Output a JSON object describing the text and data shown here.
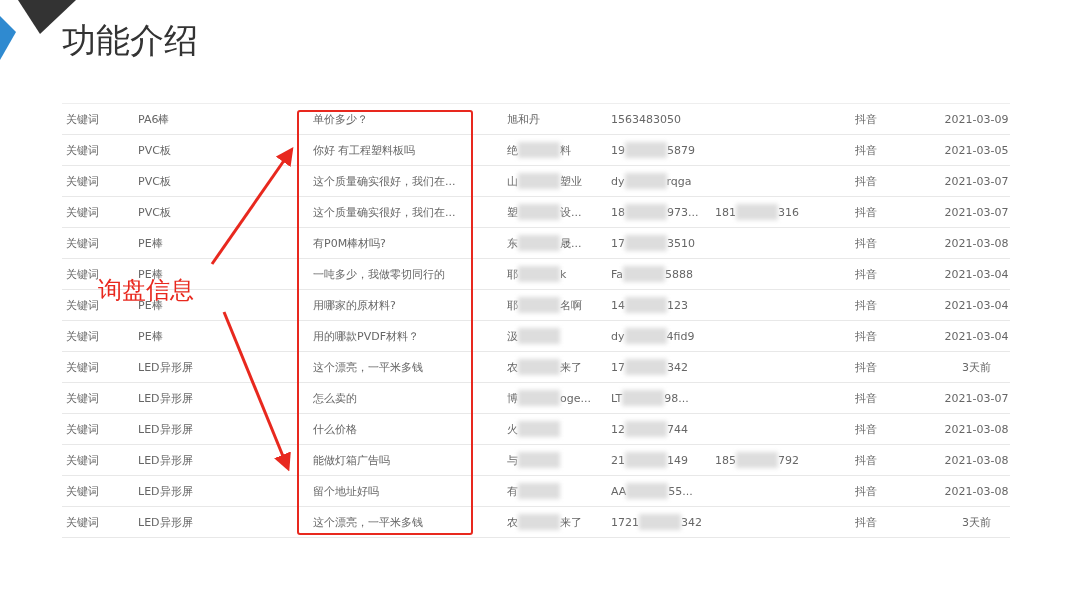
{
  "slide": {
    "title": "功能介绍"
  },
  "table": {
    "rows": [
      {
        "type": "关键词",
        "keyword": "PA6棒",
        "message": "单价多少？",
        "name": [
          "旭和丹"
        ],
        "name_tail_blurred": false,
        "contact": [
          "1563483050"
        ],
        "contact_2": [],
        "platform": "抖音",
        "date": "2021-03-09"
      },
      {
        "type": "关键词",
        "keyword": "PVC板",
        "message": "你好 有工程塑料板吗",
        "name": [
          "绝",
          "料"
        ],
        "contact": [
          "19",
          "5879"
        ],
        "contact_2": [],
        "platform": "抖音",
        "date": "2021-03-05"
      },
      {
        "type": "关键词",
        "keyword": "PVC板",
        "message": "这个质量确实很好，我们在...",
        "name": [
          "山",
          "塑业"
        ],
        "contact": [
          "dy",
          "rqga"
        ],
        "contact_2": [],
        "platform": "抖音",
        "date": "2021-03-07"
      },
      {
        "type": "关键词",
        "keyword": "PVC板",
        "message": "这个质量确实很好，我们在...",
        "name": [
          "塑",
          "设..."
        ],
        "contact": [
          "18",
          "973..."
        ],
        "contact_2": [
          "181",
          "316"
        ],
        "platform": "抖音",
        "date": "2021-03-07"
      },
      {
        "type": "关键词",
        "keyword": "PE棒",
        "message": "有P0M棒材吗?",
        "name": [
          "东",
          "晟..."
        ],
        "contact": [
          "17",
          "3510"
        ],
        "contact_2": [],
        "platform": "抖音",
        "date": "2021-03-08"
      },
      {
        "type": "关键词",
        "keyword": "PE棒",
        "message": "一吨多少，我做零切同行的",
        "name": [
          "耶",
          "k"
        ],
        "contact": [
          "Fa",
          "5888"
        ],
        "contact_2": [],
        "platform": "抖音",
        "date": "2021-03-04"
      },
      {
        "type": "关键词",
        "keyword": "PE棒",
        "message": "用哪家的原材料?",
        "name": [
          "耶",
          "名啊"
        ],
        "contact": [
          "14",
          "123"
        ],
        "contact_2": [],
        "platform": "抖音",
        "date": "2021-03-04"
      },
      {
        "type": "关键词",
        "keyword": "PE棒",
        "message": "用的哪款PVDF材料？",
        "name": [
          "汲"
        ],
        "name_tail_blurred": true,
        "contact": [
          "dy",
          "4fid9"
        ],
        "contact_2": [],
        "platform": "抖音",
        "date": "2021-03-04"
      },
      {
        "type": "关键词",
        "keyword": "LED异形屏",
        "message": "这个漂亮，一平米多钱",
        "name": [
          "农",
          "来了"
        ],
        "contact": [
          "17",
          "342"
        ],
        "contact_2": [],
        "platform": "抖音",
        "date": "3天前"
      },
      {
        "type": "关键词",
        "keyword": "LED异形屏",
        "message": "怎么卖的",
        "name": [
          "博",
          "oge..."
        ],
        "contact": [
          "LT",
          "98..."
        ],
        "contact_2": [],
        "platform": "抖音",
        "date": "2021-03-07"
      },
      {
        "type": "关键词",
        "keyword": "LED异形屏",
        "message": "什么价格",
        "name": [
          "火"
        ],
        "name_tail_blurred": true,
        "contact": [
          "12",
          "744"
        ],
        "contact_2": [],
        "platform": "抖音",
        "date": "2021-03-08"
      },
      {
        "type": "关键词",
        "keyword": "LED异形屏",
        "message": "能做灯箱广告吗",
        "name": [
          "与"
        ],
        "name_tail_blurred": true,
        "contact": [
          "21",
          "149"
        ],
        "contact_2": [
          "185",
          "792"
        ],
        "platform": "抖音",
        "date": "2021-03-08"
      },
      {
        "type": "关键词",
        "keyword": "LED异形屏",
        "message": "留个地址好吗",
        "name": [
          "有"
        ],
        "name_tail_blurred": true,
        "contact": [
          "AA",
          "55..."
        ],
        "contact_2": [],
        "platform": "抖音",
        "date": "2021-03-08"
      },
      {
        "type": "关键词",
        "keyword": "LED异形屏",
        "message": "这个漂亮，一平米多钱",
        "name": [
          "农",
          "来了"
        ],
        "contact": [
          "1721",
          "342"
        ],
        "contact_2": [],
        "platform": "抖音",
        "date": "3天前"
      }
    ]
  },
  "annotation": {
    "label": "询盘信息"
  }
}
